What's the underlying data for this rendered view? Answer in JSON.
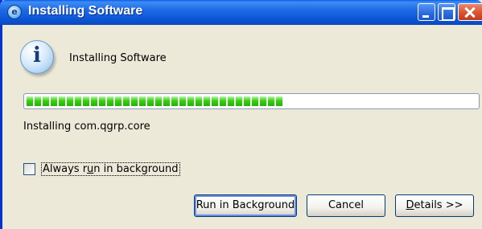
{
  "window": {
    "title": "Installing Software"
  },
  "dialog": {
    "heading": "Installing Software",
    "icon": "info-icon",
    "status_text": "Installing com.qgrp.core",
    "progress_percent": 57,
    "accent_color": "#0a5ee8",
    "progress_color": "#37d10d"
  },
  "options": {
    "always_run_in_background": {
      "label_before": "Always r",
      "label_mnemonic": "u",
      "label_after": "n in background",
      "checked": false
    }
  },
  "buttons": {
    "run_in_background": "Run in Background",
    "cancel": "Cancel",
    "details_mnemonic": "D",
    "details_rest": "etails >>"
  }
}
